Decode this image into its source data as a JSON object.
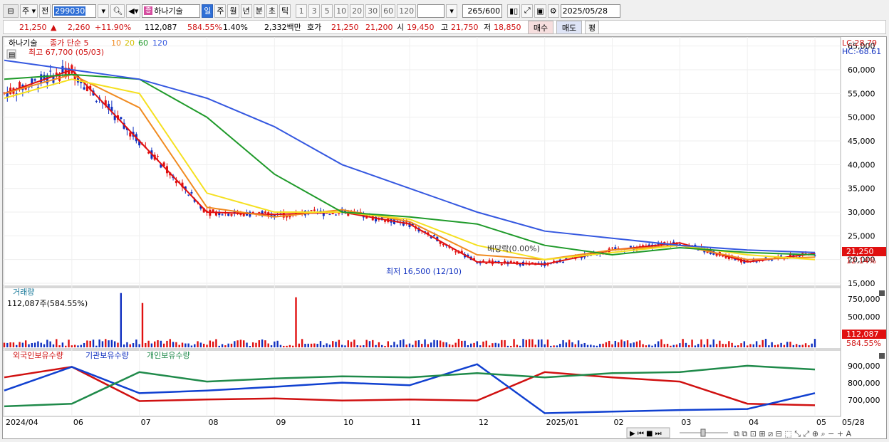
{
  "toolbar": {
    "type_label": "주",
    "prev_label": "전",
    "code": "299030",
    "stock_name": "하나기술",
    "periods": [
      "일",
      "주",
      "월",
      "년",
      "분",
      "초",
      "틱"
    ],
    "minutes": [
      "1",
      "3",
      "5",
      "10",
      "20",
      "30",
      "60",
      "120"
    ],
    "count": "265",
    "max_count": "/600",
    "date": "2025/05/28"
  },
  "status": {
    "price": "21,250",
    "change_arrow": "▲",
    "change": "2,260",
    "change_pct": "+11.90%",
    "volume": "112,087",
    "volume_pct": "584.55%",
    "turnover": "1.40%",
    "amount": "2,332백만",
    "hoga_label": "호가",
    "ask": "21,250",
    "bid": "21,200",
    "open_label": "시",
    "open": "19,450",
    "high_label": "고",
    "high": "21,750",
    "low_label": "저",
    "low": "18,850",
    "buy_label": "매수",
    "sell_label": "매도",
    "eval_label": "평"
  },
  "price_panel": {
    "name": "하나기술",
    "ma_prefix": "종가 단순 5",
    "ma_periods": [
      "10",
      "20",
      "60",
      "120"
    ],
    "high_note": "최고 67,700 (05/03)",
    "low_note": "최저 16,500 (12/10)",
    "dividend_note": "배당락(0.00%)",
    "lc": "LC:28.79",
    "hc": "HC:-68.61",
    "last_price": "21,250",
    "last_pct": "12.14%",
    "y_ticks": [
      "65,000",
      "60,000",
      "55,000",
      "50,000",
      "45,000",
      "40,000",
      "35,000",
      "30,000",
      "25,000",
      "20,000",
      "15,000"
    ]
  },
  "volume_panel": {
    "title": "거래량",
    "note": "112,087주(584.55%)",
    "y_ticks": [
      "750,000",
      "500,000",
      "250,000"
    ],
    "last": "112,087",
    "last_pct": "584.55%"
  },
  "holding_panel": {
    "legend": [
      "외국인보유수량",
      "기관보유수량",
      "개인보유수량"
    ],
    "y_ticks": [
      "900,000",
      "800,000",
      "700,000"
    ]
  },
  "x_axis": {
    "labels": [
      "2024/04",
      "06",
      "07",
      "08",
      "09",
      "10",
      "11",
      "12",
      "2025/01",
      "02",
      "03",
      "04",
      "05"
    ],
    "last_date": "05/28"
  },
  "colors": {
    "up": "#e01010",
    "down": "#1030c0",
    "ma5": "#e01010",
    "ma10": "#f08a20",
    "ma20": "#f5e020",
    "ma60": "#1f9a2a",
    "ma120": "#3558e0"
  },
  "chart_data": {
    "type": "line",
    "x": [
      "2024/04",
      "06",
      "07",
      "08",
      "09",
      "10",
      "11",
      "12",
      "2025/01",
      "02",
      "03",
      "04",
      "05"
    ],
    "series": [
      {
        "name": "5",
        "values": [
          55000,
          60000,
          45000,
          30000,
          29500,
          30000,
          27500,
          19500,
          19000,
          22000,
          23500,
          19500,
          21250
        ]
      },
      {
        "name": "10",
        "values": [
          55000,
          59000,
          52000,
          31000,
          29000,
          30500,
          28000,
          21000,
          20000,
          22000,
          23000,
          20000,
          20500
        ]
      },
      {
        "name": "20",
        "values": [
          54000,
          58000,
          55000,
          34000,
          30000,
          30000,
          28500,
          23000,
          20000,
          21500,
          23000,
          21000,
          20000
        ]
      },
      {
        "name": "60",
        "values": [
          58000,
          59000,
          58000,
          50000,
          38000,
          30000,
          29000,
          27500,
          23000,
          21000,
          22500,
          21500,
          21000
        ]
      },
      {
        "name": "120",
        "values": [
          62000,
          60000,
          58000,
          54000,
          48000,
          40000,
          35000,
          30000,
          26000,
          24500,
          23000,
          22000,
          21500
        ]
      }
    ],
    "ylim": [
      15000,
      66000
    ]
  }
}
